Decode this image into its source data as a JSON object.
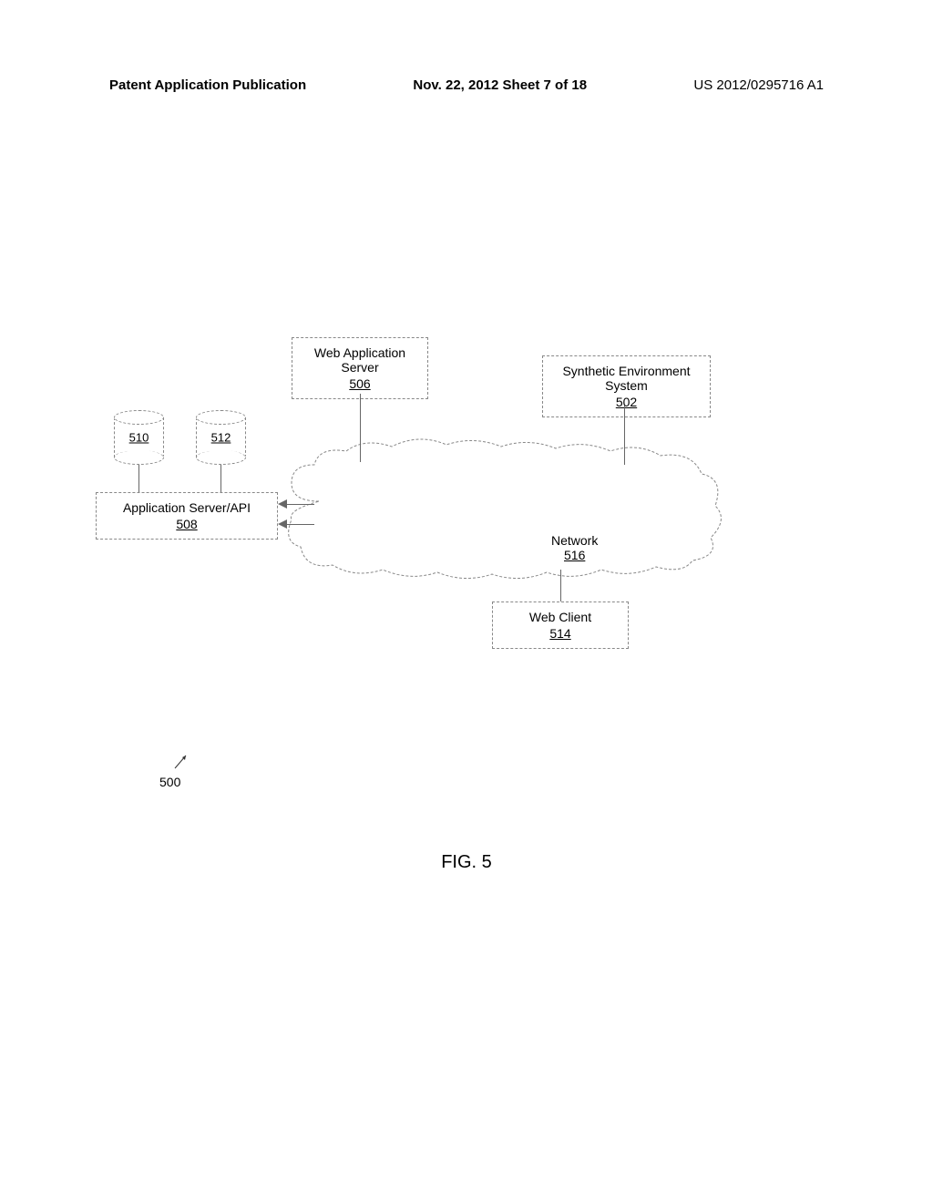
{
  "header": {
    "left": "Patent Application Publication",
    "center": "Nov. 22, 2012  Sheet 7 of 18",
    "right": "US 2012/0295716 A1"
  },
  "diagram": {
    "web_app_server": {
      "label": "Web Application Server",
      "ref": "506"
    },
    "synthetic_env": {
      "label": "Synthetic Environment System",
      "ref": "502"
    },
    "app_server_api": {
      "label": "Application Server/API",
      "ref": "508"
    },
    "web_client": {
      "label": "Web Client",
      "ref": "514"
    },
    "network": {
      "label": "Network",
      "ref": "516"
    },
    "db1_ref": "510",
    "db2_ref": "512",
    "system_ref": "500",
    "figure_label": "FIG. 5"
  }
}
